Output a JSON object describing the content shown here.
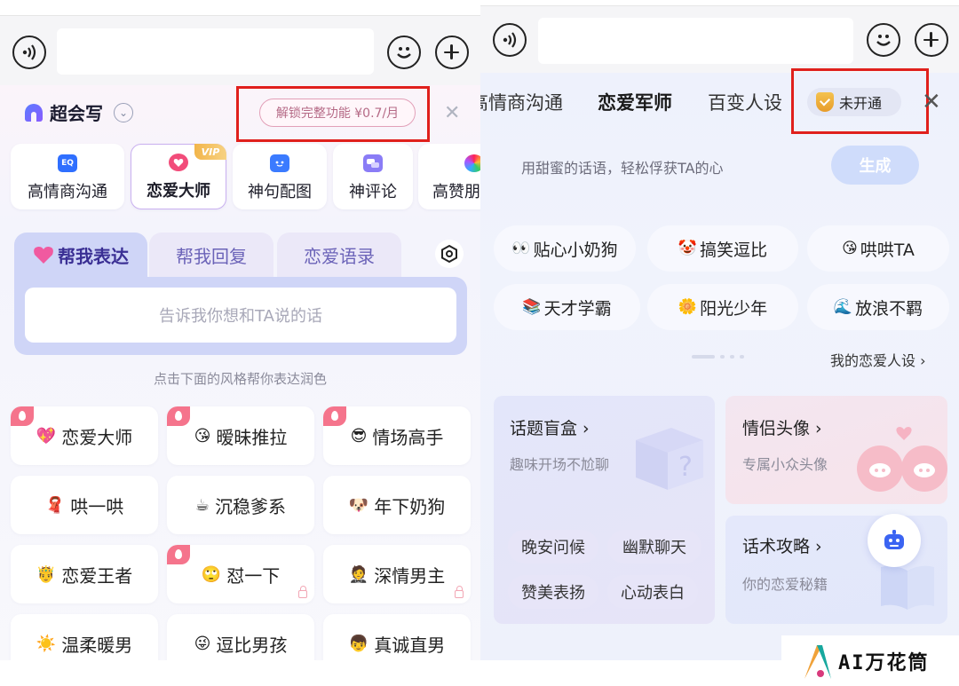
{
  "left": {
    "brand_name": "超会写",
    "unlock_label": "解锁完整功能 ¥0.7/月",
    "close_glyph": "✕",
    "features": [
      {
        "label": "高情商沟通",
        "icon": "eq-icon",
        "icon_text": "EQ"
      },
      {
        "label": "恋爱大师",
        "icon": "love-icon",
        "vip": "VIP"
      },
      {
        "label": "神句配图",
        "icon": "image-icon"
      },
      {
        "label": "神评论",
        "icon": "comment-icon"
      },
      {
        "label": "高赞朋",
        "icon": "moments-icon"
      }
    ],
    "tabs": [
      "帮我表达",
      "帮我回复",
      "恋爱语录"
    ],
    "input_placeholder": "告诉我你想和TA说的话",
    "hint": "点击下面的风格帮你表达润色",
    "styles": [
      {
        "emoji": "💖",
        "label": "恋爱大师"
      },
      {
        "emoji": "😘",
        "label": "暧昧推拉"
      },
      {
        "emoji": "😎",
        "label": "情场高手"
      },
      {
        "emoji": "🧣",
        "label": "哄一哄"
      },
      {
        "emoji": "☕",
        "label": "沉稳爹系"
      },
      {
        "emoji": "🐶",
        "label": "年下奶狗"
      },
      {
        "emoji": "🤴",
        "label": "恋爱王者"
      },
      {
        "emoji": "🙄",
        "label": "怼一下"
      },
      {
        "emoji": "🤵",
        "label": "深情男主"
      },
      {
        "emoji": "☀️",
        "label": "温柔暖男"
      },
      {
        "emoji": "😜",
        "label": "逗比男孩"
      },
      {
        "emoji": "👦",
        "label": "真诚直男"
      }
    ]
  },
  "right": {
    "tabs": [
      "高情商沟通",
      "恋爱军师",
      "百变人设"
    ],
    "unopened_label": "未开通",
    "close_glyph": "✕",
    "prompt": "用甜蜜的话语，轻松俘获TA的心",
    "generate_label": "生成",
    "personas": [
      {
        "emoji": "👀",
        "label": "贴心小奶狗"
      },
      {
        "emoji": "🤡",
        "label": "搞笑逗比"
      },
      {
        "emoji": "😘",
        "label": "哄哄TA"
      },
      {
        "emoji": "📚",
        "label": "天才学霸"
      },
      {
        "emoji": "🌼",
        "label": "阳光少年"
      },
      {
        "emoji": "🌊",
        "label": "放浪不羁"
      }
    ],
    "my_persona": "我的恋爱人设 ›",
    "cards": {
      "topic_box": {
        "title": "话题盲盒 ›",
        "subtitle": "趣味开场不尬聊",
        "chips": [
          "晚安问候",
          "幽默聊天",
          "赞美表扬",
          "心动表白"
        ]
      },
      "avatar": {
        "title": "情侣头像 ›",
        "subtitle": "专属小众头像"
      },
      "tactics": {
        "title": "话术攻略 ›",
        "subtitle": "你的恋爱秘籍"
      }
    }
  },
  "watermark": "AI万花筒",
  "colors": {
    "highlight": "#e0201c",
    "accent_purple": "#3a2f94",
    "tab_bg": "#cfd5f7"
  }
}
